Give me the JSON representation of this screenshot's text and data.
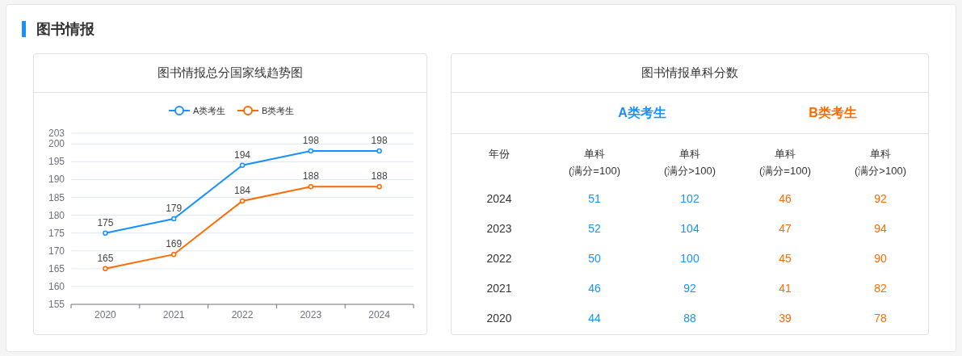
{
  "section": {
    "title": "图书情报"
  },
  "trend_card": {
    "title": "图书情报总分国家线趋势图",
    "chart_data": {
      "type": "line",
      "categories": [
        "2020",
        "2021",
        "2022",
        "2023",
        "2024"
      ],
      "series": [
        {
          "name": "A类考生",
          "color": "#1890ff",
          "marker": "circle",
          "values": [
            175,
            179,
            194,
            198,
            198
          ]
        },
        {
          "name": "B类考生",
          "color": "#ff6a00",
          "marker": "circle",
          "values": [
            165,
            169,
            184,
            188,
            188
          ]
        }
      ],
      "grid": true,
      "legend": true,
      "ylim": [
        155,
        203
      ],
      "yticks": [
        155,
        160,
        165,
        170,
        175,
        180,
        185,
        190,
        195,
        200,
        203
      ],
      "data_labels": true
    }
  },
  "score_card": {
    "title": "图书情报单科分数",
    "groups": [
      {
        "label": "A类考生",
        "color": "#1890ff"
      },
      {
        "label": "B类考生",
        "color": "#ff6a00"
      }
    ],
    "columns": [
      {
        "line1": "年份"
      },
      {
        "line1": "单科",
        "line2": "(满分=100)"
      },
      {
        "line1": "单科",
        "line2": "(满分>100)"
      },
      {
        "line1": "单科",
        "line2": "(满分=100)"
      },
      {
        "line1": "单科",
        "line2": "(满分>100)"
      }
    ],
    "rows": [
      [
        "2024",
        "51",
        "102",
        "46",
        "92"
      ],
      [
        "2023",
        "52",
        "104",
        "47",
        "94"
      ],
      [
        "2022",
        "50",
        "100",
        "45",
        "90"
      ],
      [
        "2021",
        "46",
        "92",
        "41",
        "82"
      ],
      [
        "2020",
        "44",
        "88",
        "39",
        "78"
      ]
    ]
  }
}
